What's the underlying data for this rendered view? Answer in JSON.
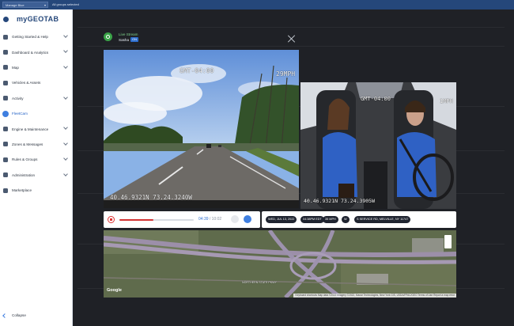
{
  "header": {
    "database": "Manage Blue",
    "groups_filter": "All groups selected"
  },
  "brand": {
    "logo": "myGEOTAB",
    "color": "#25477a"
  },
  "sidebar": {
    "items": [
      {
        "label": "Getting Started & Help",
        "icon": "help-icon",
        "has_children": true
      },
      {
        "label": "Dashboard & Analytics",
        "icon": "dashboard-icon",
        "has_children": true
      },
      {
        "label": "Map",
        "icon": "map-icon",
        "has_children": true
      },
      {
        "label": "Vehicles & Assets",
        "icon": "truck-icon",
        "has_children": false
      },
      {
        "label": "Activity",
        "icon": "activity-icon",
        "has_children": true
      },
      {
        "label": "FleetCam",
        "icon": "camera-icon",
        "has_children": false,
        "active": true
      },
      {
        "label": "Engine & Maintenance",
        "icon": "wrench-icon",
        "has_children": true
      },
      {
        "label": "Zones & Messages",
        "icon": "zone-icon",
        "has_children": true
      },
      {
        "label": "Rules & Groups",
        "icon": "rules-icon",
        "has_children": true
      },
      {
        "label": "Administration",
        "icon": "gear-icon",
        "has_children": true
      },
      {
        "label": "Marketplace",
        "icon": "marketplace-icon",
        "has_children": false
      }
    ],
    "collapse_label": "Collapse",
    "active_color": "#3f7fe0"
  },
  "modal": {
    "live_label": "Live Stream",
    "driver": "Sasha",
    "driver_badge": "ON",
    "live_color": "#3aa348"
  },
  "road_camera": {
    "timestamp": "GMT-04:00",
    "speed": "29MPH",
    "coordinates": "40.46.9321N 73.24.3240W"
  },
  "cabin_camera": {
    "timestamp": "GMT-04:00",
    "speed": "1MPH",
    "coordinates": "40.46.9321N 73.24.3905W"
  },
  "player": {
    "elapsed": "04:39",
    "total": "/ 10:02",
    "progress": 0.46,
    "progress_color": "#d33333"
  },
  "trip_info": {
    "date": "WED, JUL 13, 2022",
    "time": "04:38PM EDT",
    "speed": "35 MPH",
    "heading": "W",
    "address": "S SERVICE RD, MELVILLE, NY 11747"
  },
  "map": {
    "provider": "Google",
    "attribution": "Keyboard shortcuts   Map data ©2022 Imagery ©2022, Maxar Technologies, New York GIS, USDA/FPAC/GEO   Terms of Use   Report a map error",
    "road_label": "NORTHERN STATE PKWY"
  }
}
